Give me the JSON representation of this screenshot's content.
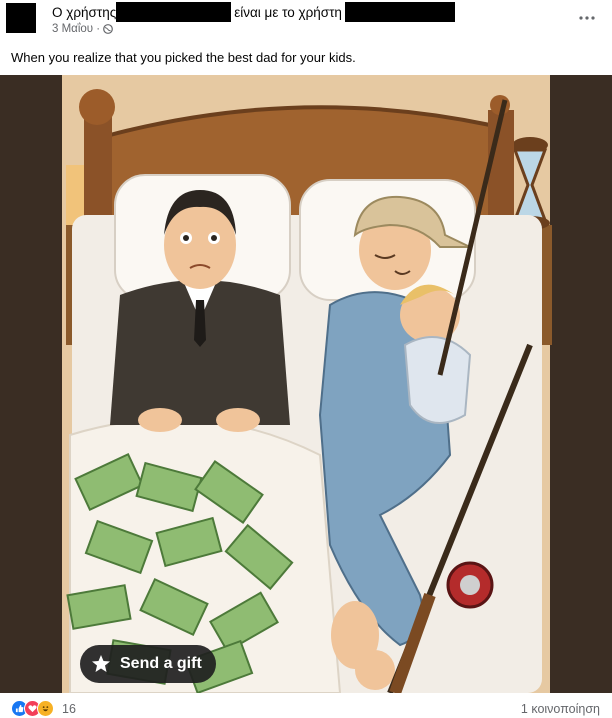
{
  "post": {
    "author_prefix": "Ο χρήστης",
    "with_text": "είναι με το χρήστη",
    "date": "3 Μαΐου ·",
    "caption": "When you realize that you picked the best dad for your kids."
  },
  "image": {
    "gift_label": "Send a gift"
  },
  "footer": {
    "reaction_count": "16",
    "shares": "1 κοινοποίηση"
  },
  "icons": [
    "more-icon",
    "globe-icon",
    "gift-icon",
    "like-icon",
    "love-icon",
    "haha-icon"
  ],
  "colors": {
    "like": "#1877f2",
    "love": "#f33e58",
    "haha": "#f7b125",
    "meta_text": "#65676b"
  }
}
